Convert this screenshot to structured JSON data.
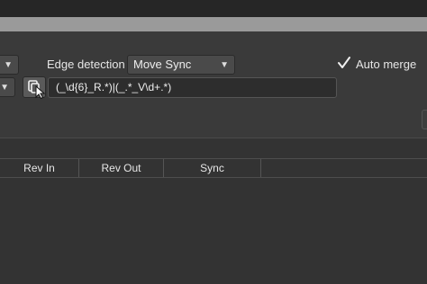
{
  "toolbar": {
    "edge_detection_label": "Edge detection",
    "edge_detection_value": "Move Sync",
    "auto_merge_label": "Auto merge",
    "auto_merge_checked": true,
    "regex_value": "(_\\d{6}_R.*)|(_.*_V\\d+.*)"
  },
  "table": {
    "columns": [
      "Rev In",
      "Rev Out",
      "Sync"
    ]
  },
  "icons": {
    "dropdown_arrow": "chevron-down-icon",
    "regex_button": "copy-icon",
    "cursor": "pointer-cursor-icon",
    "checkmark": "check-icon"
  }
}
